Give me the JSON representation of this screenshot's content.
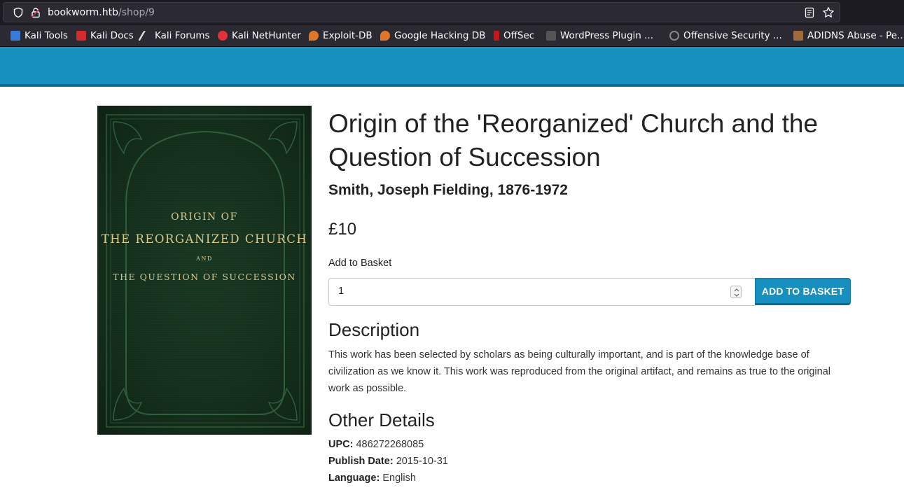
{
  "browser": {
    "url_host": "bookworm.htb",
    "url_path": "/shop/9"
  },
  "bookmarks": [
    {
      "label": "Kali Tools",
      "icon": "kali-tools-icon",
      "color": "#3a7bd5"
    },
    {
      "label": "Kali Docs",
      "icon": "kali-docs-icon",
      "color": "#d42c2c"
    },
    {
      "label": "Kali Forums",
      "icon": "kali-forums-icon",
      "color": "#dddddd"
    },
    {
      "label": "Kali NetHunter",
      "icon": "kali-nethunter-icon",
      "color": "#e0323a"
    },
    {
      "label": "Exploit-DB",
      "icon": "exploit-db-icon",
      "color": "#e0762b"
    },
    {
      "label": "Google Hacking DB",
      "icon": "ghdb-icon",
      "color": "#e0762b"
    },
    {
      "label": "OffSec",
      "icon": "offsec-icon",
      "color": "#c4161c"
    },
    {
      "label": "WordPress Plugin ...",
      "icon": "wordpress-icon",
      "color": "#555555"
    },
    {
      "label": "Offensive Security ...",
      "icon": "offensive-security-icon",
      "color": "#888888"
    },
    {
      "label": "ADIDNS Abuse - Pe...",
      "icon": "adidns-icon",
      "color": "#a06b3b"
    }
  ],
  "product": {
    "title": "Origin of the 'Reorganized' Church and the Question of Succession",
    "author": "Smith, Joseph Fielding, 1876-1972",
    "price": "£10",
    "basket_label": "Add to Basket",
    "quantity": "1",
    "add_button": "ADD TO BASKET",
    "cover": {
      "line1": "ORIGIN OF",
      "line2": "THE REORGANIZED CHURCH",
      "line3": "AND",
      "line4": "THE QUESTION OF SUCCESSION"
    }
  },
  "description": {
    "heading": "Description",
    "text": "This work has been selected by scholars as being culturally important, and is part of the knowledge base of civilization as we know it. This work was reproduced from the original artifact, and remains as true to the original work as possible."
  },
  "details": {
    "heading": "Other Details",
    "upc_label": "UPC:",
    "upc": "486272268085",
    "publish_label": "Publish Date:",
    "publish_date": "2015-10-31",
    "language_label": "Language:",
    "language": "English"
  },
  "colors": {
    "header": "#178fbf",
    "button": "#178fbf",
    "cover": "#16321f"
  }
}
